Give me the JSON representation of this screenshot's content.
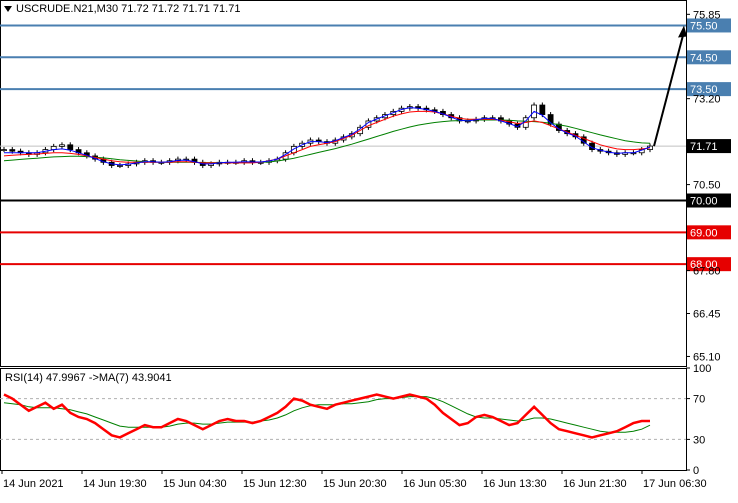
{
  "header": {
    "symbol": "USCRUDE.N21,M30",
    "ohlc": "71.72 71.72 71.71 71.71"
  },
  "rsi_header": {
    "label": "RSI(14) 47.9967",
    "ma_label": "->MA(7) 43.9041"
  },
  "colors": {
    "blue_levels": "#4a7fb0",
    "black_level": "#000000",
    "red_levels": "#e60000",
    "ma_red": "#ff0000",
    "ma_green": "#008000",
    "ma_blue": "#0000ff",
    "rsi_line": "#ff0000",
    "rsi_ma": "#008000"
  },
  "chart_data": [
    {
      "type": "candlestick",
      "symbol": "USCRUDE.N21,M30",
      "ylim": [
        64.8,
        76.3
      ],
      "y_ticks": [
        "75.85",
        "73.20",
        "70.50",
        "67.80",
        "66.45",
        "65.10"
      ],
      "x_ticks": [
        "14 Jun 2021",
        "14 Jun 19:30",
        "15 Jun 04:30",
        "15 Jun 12:30",
        "15 Jun 20:30",
        "16 Jun 05:30",
        "16 Jun 13:30",
        "16 Jun 21:30",
        "17 Jun 06:30"
      ],
      "levels": [
        {
          "price": 75.5,
          "label": "75.50",
          "color": "blue"
        },
        {
          "price": 74.5,
          "label": "74.50",
          "color": "blue"
        },
        {
          "price": 73.5,
          "label": "73.50",
          "color": "blue"
        },
        {
          "price": 70.0,
          "label": "70.00",
          "color": "black"
        },
        {
          "price": 69.0,
          "label": "69.00",
          "color": "red"
        },
        {
          "price": 68.0,
          "label": "68.00",
          "color": "red"
        }
      ],
      "current_price": {
        "price": 71.71,
        "label": "71.71"
      },
      "closes": [
        71.6,
        71.55,
        71.5,
        71.45,
        71.5,
        71.6,
        71.7,
        71.75,
        71.6,
        71.5,
        71.4,
        71.3,
        71.2,
        71.1,
        71.1,
        71.15,
        71.2,
        71.25,
        71.2,
        71.2,
        71.25,
        71.3,
        71.3,
        71.2,
        71.1,
        71.15,
        71.2,
        71.2,
        71.2,
        71.25,
        71.2,
        71.2,
        71.25,
        71.3,
        71.5,
        71.7,
        71.8,
        71.9,
        71.85,
        71.8,
        71.9,
        72.0,
        72.1,
        72.3,
        72.5,
        72.6,
        72.7,
        72.8,
        72.9,
        72.95,
        72.9,
        72.85,
        72.8,
        72.7,
        72.6,
        72.5,
        72.5,
        72.55,
        72.6,
        72.6,
        72.5,
        72.4,
        72.3,
        72.6,
        73.0,
        72.7,
        72.4,
        72.2,
        72.1,
        72.0,
        71.8,
        71.6,
        71.55,
        71.5,
        71.45,
        71.5,
        71.5,
        71.6,
        71.71
      ],
      "ma_red": [
        71.4,
        71.42,
        71.44,
        71.45,
        71.46,
        71.48,
        71.5,
        71.5,
        71.48,
        71.45,
        71.4,
        71.35,
        71.3,
        71.25,
        71.22,
        71.2,
        71.2,
        71.2,
        71.2,
        71.2,
        71.2,
        71.22,
        71.22,
        71.2,
        71.18,
        71.18,
        71.18,
        71.18,
        71.18,
        71.18,
        71.18,
        71.2,
        71.25,
        71.3,
        71.4,
        71.5,
        71.6,
        71.7,
        71.75,
        71.8,
        71.85,
        71.95,
        72.05,
        72.2,
        72.35,
        72.45,
        72.55,
        72.65,
        72.72,
        72.78,
        72.8,
        72.8,
        72.78,
        72.72,
        72.65,
        72.58,
        72.55,
        72.55,
        72.55,
        72.55,
        72.52,
        72.48,
        72.42,
        72.45,
        72.5,
        72.45,
        72.35,
        72.25,
        72.15,
        72.05,
        71.95,
        71.85,
        71.75,
        71.68,
        71.62,
        71.6,
        71.6,
        71.62,
        71.65
      ],
      "ma_green": [
        71.25,
        71.27,
        71.29,
        71.31,
        71.33,
        71.35,
        71.37,
        71.38,
        71.39,
        71.39,
        71.38,
        71.36,
        71.34,
        71.31,
        71.28,
        71.26,
        71.24,
        71.22,
        71.21,
        71.2,
        71.2,
        71.2,
        71.2,
        71.2,
        71.19,
        71.19,
        71.19,
        71.19,
        71.19,
        71.19,
        71.19,
        71.2,
        71.21,
        71.24,
        71.28,
        71.33,
        71.39,
        71.45,
        71.51,
        71.57,
        71.63,
        71.7,
        71.77,
        71.85,
        71.93,
        72.01,
        72.09,
        72.17,
        72.24,
        72.31,
        72.37,
        72.41,
        72.45,
        72.48,
        72.5,
        72.51,
        72.52,
        72.53,
        72.53,
        72.53,
        72.53,
        72.52,
        72.5,
        72.49,
        72.48,
        72.46,
        72.43,
        72.38,
        72.33,
        72.27,
        72.2,
        72.13,
        72.06,
        72.0,
        71.94,
        71.88,
        71.84,
        71.81,
        71.8
      ],
      "ma_blue": [
        71.5,
        71.5,
        71.5,
        71.5,
        71.5,
        71.55,
        71.6,
        71.62,
        71.58,
        71.5,
        71.42,
        71.32,
        71.22,
        71.15,
        71.12,
        71.14,
        71.18,
        71.22,
        71.22,
        71.2,
        71.22,
        71.26,
        71.27,
        71.22,
        71.15,
        71.15,
        71.18,
        71.2,
        71.2,
        71.22,
        71.21,
        71.21,
        71.24,
        71.3,
        71.45,
        71.62,
        71.75,
        71.85,
        71.85,
        71.82,
        71.88,
        71.98,
        72.08,
        72.25,
        72.45,
        72.56,
        72.66,
        72.76,
        72.86,
        72.92,
        72.9,
        72.86,
        72.8,
        72.72,
        72.62,
        72.52,
        72.5,
        72.54,
        72.58,
        72.58,
        72.5,
        72.42,
        72.32,
        72.5,
        72.8,
        72.68,
        72.44,
        72.25,
        72.12,
        72.02,
        71.84,
        71.66,
        71.58,
        71.52,
        71.48,
        71.5,
        71.5,
        71.58,
        71.68
      ],
      "projection": {
        "from": 71.71,
        "to": 75.5
      }
    },
    {
      "type": "line",
      "name": "RSI(14)",
      "ylim": [
        0,
        100
      ],
      "y_ticks": [
        "100",
        "70",
        "30",
        "0"
      ],
      "levels": [
        70,
        30
      ],
      "rsi": [
        74,
        70,
        64,
        58,
        62,
        66,
        60,
        64,
        56,
        52,
        50,
        46,
        40,
        34,
        32,
        36,
        40,
        44,
        42,
        42,
        46,
        50,
        48,
        44,
        40,
        44,
        48,
        50,
        48,
        48,
        46,
        48,
        52,
        56,
        62,
        70,
        68,
        64,
        62,
        60,
        64,
        66,
        68,
        70,
        72,
        74,
        72,
        70,
        72,
        74,
        72,
        70,
        64,
        56,
        50,
        44,
        46,
        52,
        54,
        52,
        48,
        44,
        46,
        54,
        62,
        54,
        46,
        40,
        38,
        36,
        34,
        32,
        34,
        36,
        38,
        42,
        46,
        48,
        47.9967
      ],
      "rsi_ma": [
        66,
        65,
        64,
        62,
        61,
        61,
        61,
        60,
        59,
        57,
        55,
        52,
        49,
        46,
        43,
        42,
        42,
        42,
        42,
        42,
        43,
        45,
        46,
        46,
        45,
        45,
        46,
        47,
        47,
        47,
        47,
        48,
        49,
        51,
        54,
        58,
        61,
        63,
        64,
        64,
        64,
        65,
        65,
        66,
        67,
        69,
        70,
        70,
        71,
        72,
        72,
        72,
        70,
        67,
        63,
        59,
        55,
        52,
        51,
        51,
        50,
        49,
        48,
        49,
        51,
        51,
        50,
        48,
        46,
        44,
        42,
        40,
        38,
        37,
        37,
        37,
        38,
        40,
        43.9041
      ]
    }
  ]
}
